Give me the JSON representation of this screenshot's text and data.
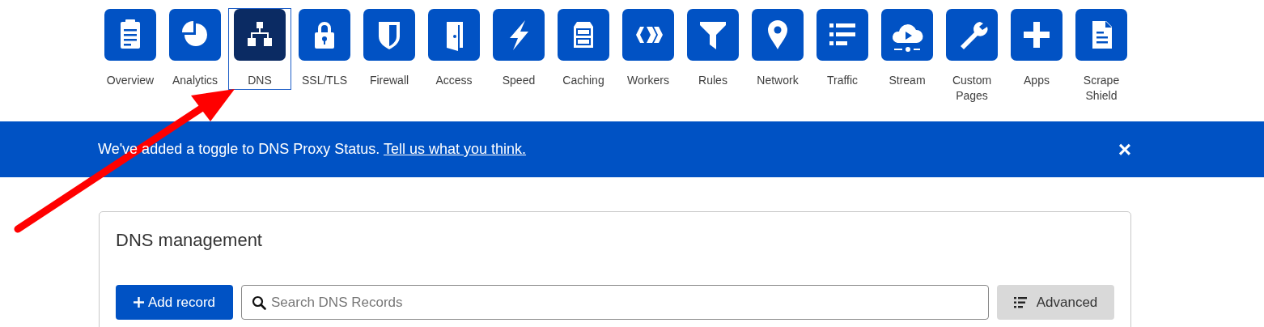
{
  "nav": [
    {
      "label": "Overview",
      "selected": false
    },
    {
      "label": "Analytics",
      "selected": false
    },
    {
      "label": "DNS",
      "selected": true
    },
    {
      "label": "SSL/TLS",
      "selected": false
    },
    {
      "label": "Firewall",
      "selected": false
    },
    {
      "label": "Access",
      "selected": false
    },
    {
      "label": "Speed",
      "selected": false
    },
    {
      "label": "Caching",
      "selected": false
    },
    {
      "label": "Workers",
      "selected": false
    },
    {
      "label": "Rules",
      "selected": false
    },
    {
      "label": "Network",
      "selected": false
    },
    {
      "label": "Traffic",
      "selected": false
    },
    {
      "label": "Stream",
      "selected": false
    },
    {
      "label": "Custom Pages",
      "selected": false
    },
    {
      "label": "Apps",
      "selected": false
    },
    {
      "label": "Scrape Shield",
      "selected": false
    }
  ],
  "banner": {
    "text": "We've added a toggle to DNS Proxy Status.",
    "link": "Tell us what you think.",
    "close": "×"
  },
  "card": {
    "title": "DNS management",
    "add_button": "Add record",
    "search": {
      "placeholder": "Search DNS Records"
    },
    "advanced_button": "Advanced"
  }
}
